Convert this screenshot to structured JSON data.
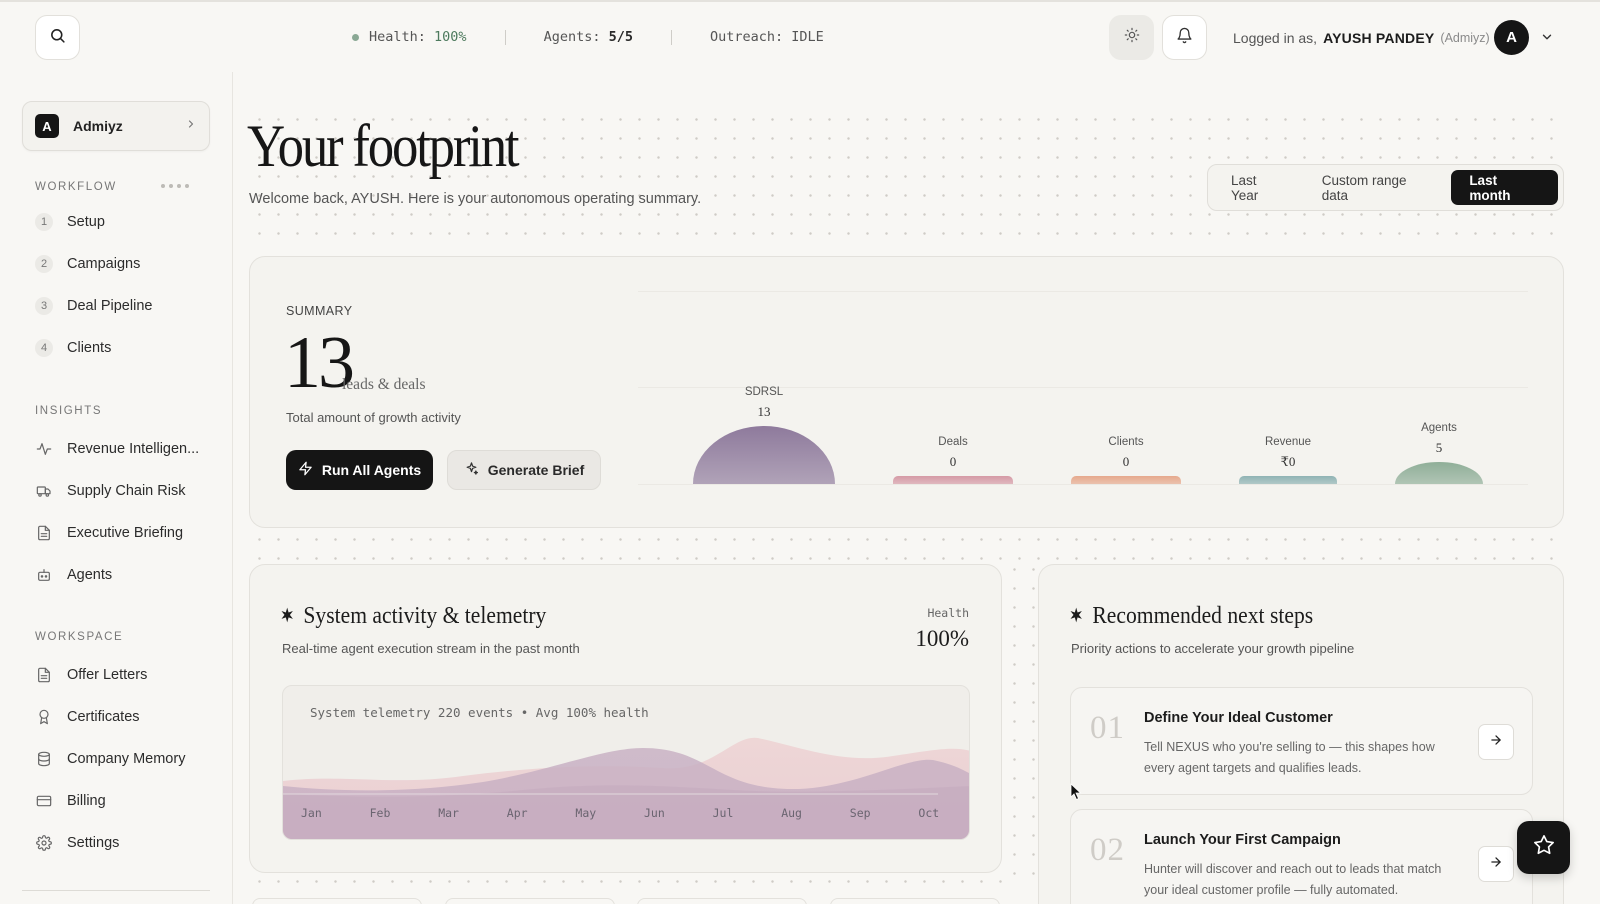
{
  "topbar": {
    "health_label": "Health:",
    "health_value": "100%",
    "agents_label": "Agents:",
    "agents_value": "5/5",
    "outreach_label": "Outreach:",
    "outreach_value": "IDLE",
    "logged_in_prefix": "Logged in as,",
    "user_name": "AYUSH PANDEY",
    "org_tag": "(Admiyz)",
    "avatar_initial": "A"
  },
  "sidebar": {
    "org": {
      "initial": "A",
      "name": "Admiyz"
    },
    "workflow_title": "WORKFLOW",
    "workflow": [
      {
        "num": "1",
        "label": "Setup"
      },
      {
        "num": "2",
        "label": "Campaigns"
      },
      {
        "num": "3",
        "label": "Deal Pipeline"
      },
      {
        "num": "4",
        "label": "Clients"
      }
    ],
    "insights_title": "INSIGHTS",
    "insights": [
      {
        "icon": "activity-icon",
        "label": "Revenue Intelligen..."
      },
      {
        "icon": "truck-icon",
        "label": "Supply Chain Risk"
      },
      {
        "icon": "document-icon",
        "label": "Executive Briefing"
      },
      {
        "icon": "bot-icon",
        "label": "Agents"
      }
    ],
    "workspace_title": "WORKSPACE",
    "workspace": [
      {
        "icon": "document-icon",
        "label": "Offer Letters"
      },
      {
        "icon": "award-icon",
        "label": "Certificates"
      },
      {
        "icon": "database-icon",
        "label": "Company Memory"
      },
      {
        "icon": "credit-card-icon",
        "label": "Billing"
      },
      {
        "icon": "gear-icon",
        "label": "Settings"
      }
    ]
  },
  "header": {
    "title": "Your footprint",
    "subtitle": "Welcome back, AYUSH. Here is your autonomous operating summary.",
    "ranges": [
      "Last Year",
      "Custom range data",
      "Last month"
    ],
    "active_range": "Last month"
  },
  "summary": {
    "label": "SUMMARY",
    "total": "13",
    "unit": "leads & deals",
    "description": "Total amount of growth activity",
    "run_button": "Run All Agents",
    "brief_button": "Generate Brief",
    "metrics": [
      {
        "label": "SDRSL",
        "value": "13",
        "level": 1.0,
        "color": "#8e7a9c"
      },
      {
        "label": "Deals",
        "value": "0",
        "level": 0.0,
        "color": "#d59aa6"
      },
      {
        "label": "Clients",
        "value": "0",
        "level": 0.0,
        "color": "#e6a98d"
      },
      {
        "label": "Revenue",
        "value": "₹0",
        "level": 0.0,
        "color": "#8fb3b4"
      },
      {
        "label": "Agents",
        "value": "5",
        "level": 0.38,
        "color": "#8fae98"
      }
    ]
  },
  "telemetry": {
    "title": "System activity & telemetry",
    "subtitle": "Real-time agent execution stream in the past month",
    "health_label": "Health",
    "health_value": "100%",
    "caption": "System telemetry 220 events • Avg 100% health",
    "months": [
      "Jan",
      "Feb",
      "Mar",
      "Apr",
      "May",
      "Jun",
      "Jul",
      "Aug",
      "Sep",
      "Oct"
    ]
  },
  "next_steps": {
    "title": "Recommended next steps",
    "subtitle": "Priority actions to accelerate your growth pipeline",
    "items": [
      {
        "num": "01",
        "title": "Define Your Ideal Customer",
        "desc": "Tell NEXUS who you're selling to — this shapes how every agent targets and qualifies leads."
      },
      {
        "num": "02",
        "title": "Launch Your First Campaign",
        "desc": "Hunter will discover and reach out to leads that match your ideal customer profile — fully automated."
      }
    ]
  },
  "colors": {
    "accent_dark": "#151515",
    "health_green": "#4d7a5d",
    "background": "#f8f7f4"
  }
}
